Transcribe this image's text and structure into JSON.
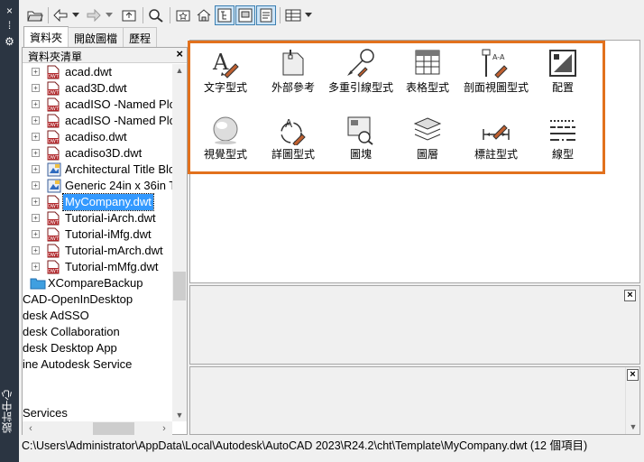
{
  "side_strip": {
    "title": "設計中心",
    "buttons": [
      "×",
      "⁞",
      "⚙"
    ]
  },
  "tabs": [
    {
      "label": "資料夾",
      "active": true
    },
    {
      "label": "開啟圖檔",
      "active": false
    },
    {
      "label": "歷程",
      "active": false
    }
  ],
  "tree": {
    "header": "資料夾清單",
    "close_label": "×",
    "rows": [
      {
        "label": "acad.dwt",
        "type": "dwt"
      },
      {
        "label": "acad3D.dwt",
        "type": "dwt"
      },
      {
        "label": "acadISO -Named Plo",
        "type": "dwt"
      },
      {
        "label": "acadISO -Named Plo",
        "type": "dwt"
      },
      {
        "label": "acadiso.dwt",
        "type": "dwt"
      },
      {
        "label": "acadiso3D.dwt",
        "type": "dwt"
      },
      {
        "label": "Architectural Title Blo",
        "type": "tb"
      },
      {
        "label": "Generic 24in x 36in Ti",
        "type": "tb"
      },
      {
        "label": "MyCompany.dwt",
        "type": "dwt",
        "selected": true
      },
      {
        "label": "Tutorial-iArch.dwt",
        "type": "dwt"
      },
      {
        "label": "Tutorial-iMfg.dwt",
        "type": "dwt"
      },
      {
        "label": "Tutorial-mArch.dwt",
        "type": "dwt"
      },
      {
        "label": "Tutorial-mMfg.dwt",
        "type": "dwt"
      },
      {
        "label": "XCompareBackup",
        "type": "folder"
      },
      {
        "label": "CAD-OpenInDesktop",
        "type": "plain"
      },
      {
        "label": "desk AdSSO",
        "type": "plain"
      },
      {
        "label": "desk Collaboration",
        "type": "plain"
      },
      {
        "label": "desk Desktop App",
        "type": "plain"
      },
      {
        "label": "ine Autodesk Service",
        "type": "plain"
      },
      {
        "label": "",
        "type": "plain"
      },
      {
        "label": "",
        "type": "plain"
      },
      {
        "label": "Services",
        "type": "plain"
      }
    ]
  },
  "content_items": [
    {
      "label": "文字型式",
      "icon": "text-style-icon"
    },
    {
      "label": "外部參考",
      "icon": "xref-icon"
    },
    {
      "label": "多重引線型式",
      "icon": "multileader-style-icon"
    },
    {
      "label": "表格型式",
      "icon": "table-style-icon"
    },
    {
      "label": "剖面視圖型式",
      "icon": "section-view-style-icon"
    },
    {
      "label": "配置",
      "icon": "layout-icon"
    },
    {
      "label": "視覺型式",
      "icon": "visual-style-icon"
    },
    {
      "label": "詳圖型式",
      "icon": "detail-view-style-icon"
    },
    {
      "label": "圖塊",
      "icon": "block-icon"
    },
    {
      "label": "圖層",
      "icon": "layer-icon"
    },
    {
      "label": "標註型式",
      "icon": "dimension-style-icon"
    },
    {
      "label": "線型",
      "icon": "linetype-icon"
    }
  ],
  "panel_close_label": "×",
  "status_bar": "C:\\Users\\Administrator\\AppData\\Local\\Autodesk\\AutoCAD 2023\\R24.2\\cht\\Template\\MyCompany.dwt (12 個項目)",
  "colors": {
    "highlight": "#e2711d",
    "selection": "#3399ff",
    "side_strip": "#2b3542"
  }
}
